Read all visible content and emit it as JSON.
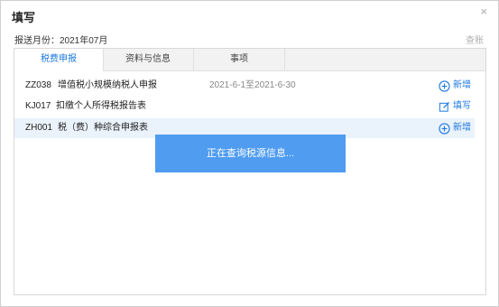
{
  "dialog": {
    "title": "填写",
    "close_icon": "×",
    "period_label": "报送月份：",
    "period_value": "2021年07月",
    "reset_label": "查账"
  },
  "tabs": [
    {
      "label": "税费申报",
      "active": true
    },
    {
      "label": "资料与信息",
      "active": false
    },
    {
      "label": "事项",
      "active": false
    }
  ],
  "rows": [
    {
      "code": "ZZ038",
      "name": "增值税小规模纳税人申报",
      "date": "2021-6-1至2021-6-30",
      "action": "新增",
      "action_icon": "plus-circle-icon"
    },
    {
      "code": "KJ017",
      "name": "扣缴个人所得税报告表",
      "date": "",
      "action": "填写",
      "action_icon": "edit-icon"
    },
    {
      "code": "ZH001",
      "name": "税（费）种综合申报表",
      "date": "",
      "action": "新增",
      "action_icon": "plus-circle-icon"
    }
  ],
  "loading": {
    "text": "正在查询税源信息..."
  },
  "colors": {
    "accent": "#1f7ae0",
    "loading_bg": "#4f9cf0",
    "row_highlight": "#eaf2fb"
  }
}
